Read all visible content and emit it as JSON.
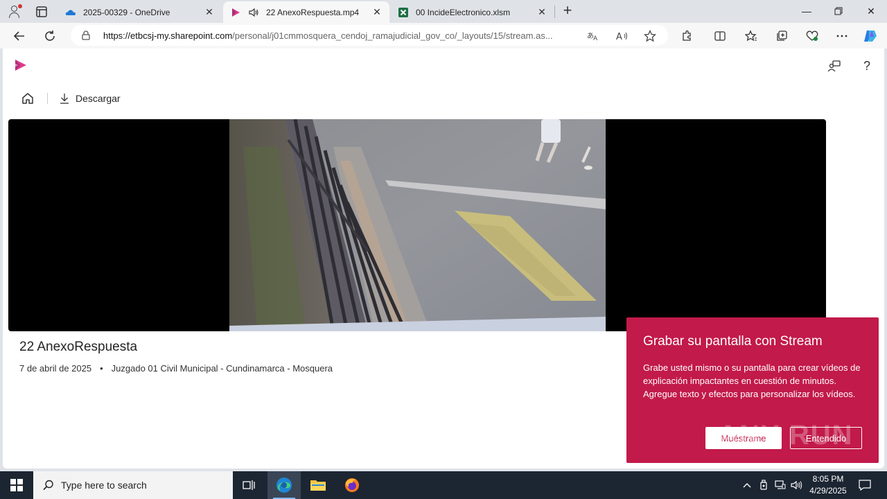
{
  "browser": {
    "tabs": [
      {
        "title": "2025-00329 - OneDrive",
        "icon": "onedrive-icon",
        "active": false
      },
      {
        "title": "22 AnexoRespuesta.mp4",
        "icon": "stream-icon",
        "active": true
      },
      {
        "title": "00 IncideElectronico.xlsm",
        "icon": "excel-icon",
        "active": false
      }
    ],
    "url_domain": "https://etbcsj-my.sharepoint.com",
    "url_path": "/personal/j01cmmosquera_cendoj_ramajudicial_gov_co/_layouts/15/stream.as..."
  },
  "page": {
    "download_label": "Descargar",
    "video_title": "22 AnexoRespuesta",
    "video_date": "7 de abril de 2025",
    "meta_bullet": "•",
    "video_owner": "Juzgado 01 Civil Municipal - Cundinamarca - Mosquera",
    "help_label": "?"
  },
  "bubble": {
    "title": "Grabar su pantalla con Stream",
    "body": "Grabe usted mismo o su pantalla para crear vídeos de explicación impactantes en cuestión de minutos. Agregue texto y efectos para personalizar los vídeos.",
    "primary": "Muéstrame",
    "secondary": "Entendido",
    "watermark": "ANY RUN"
  },
  "taskbar": {
    "search_placeholder": "Type here to search",
    "time": "8:05 PM",
    "date": "4/29/2025"
  },
  "colors": {
    "accent": "#c21a4a",
    "stream": "#e03c8a"
  }
}
